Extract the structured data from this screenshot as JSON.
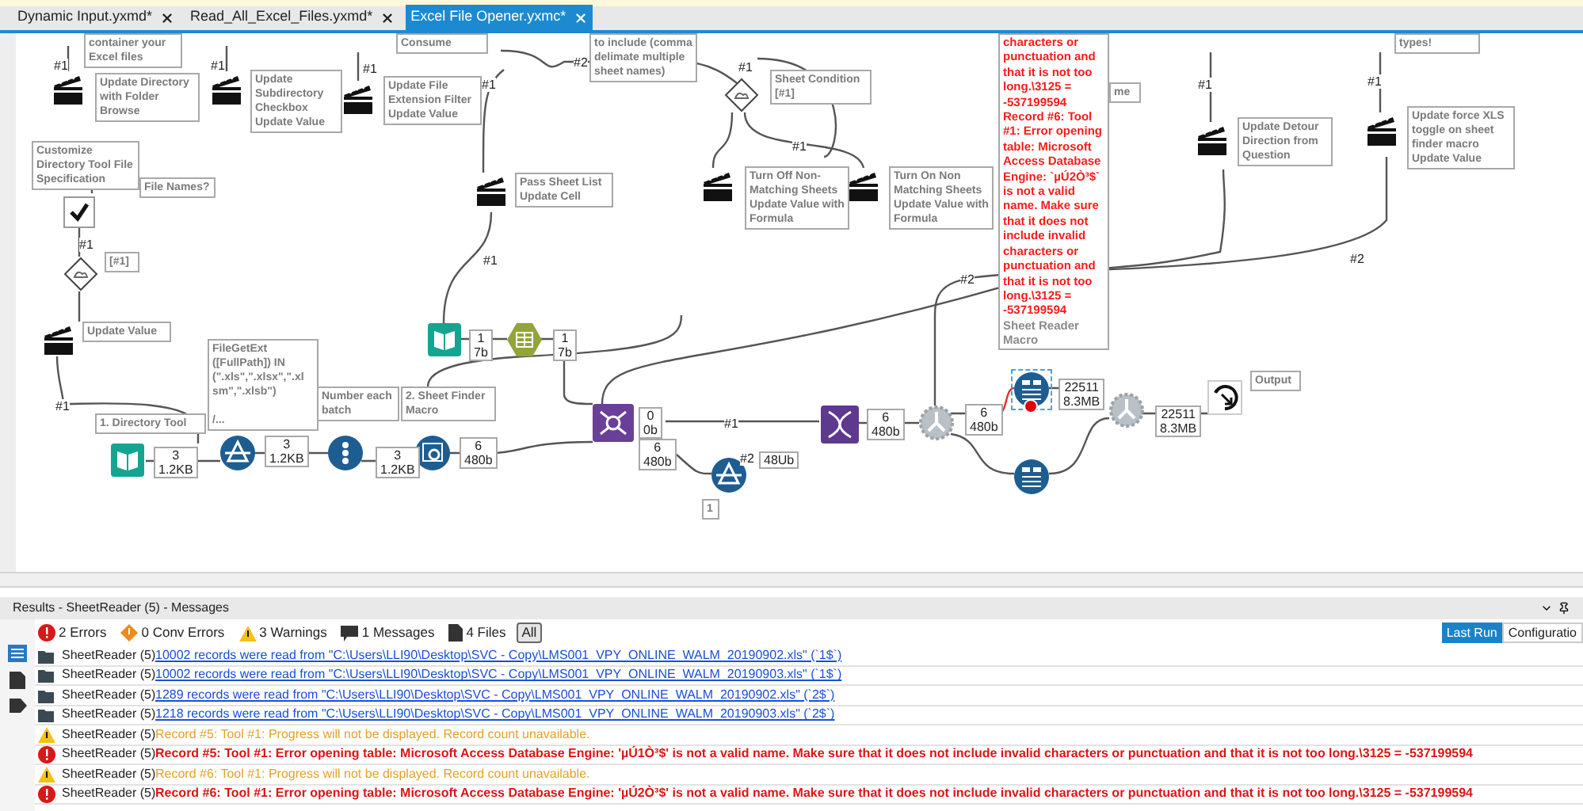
{
  "tabs": [
    {
      "label": "Dynamic Input.yxmd*",
      "selected": false
    },
    {
      "label": "Read_All_Excel_Files.yxmd*",
      "selected": false
    },
    {
      "label": "Excel File Opener.yxmc*",
      "selected": true
    }
  ],
  "canvas": {
    "annotations": [
      "container your Excel files",
      "Consume",
      "to include (comma delimate multiple sheet names)",
      "types!",
      "Update Directory with Folder Browse",
      "Update Subdirectory Checkbox Update Value",
      "Update File Extension Filter Update Value",
      "Sheet Condition [#1]",
      "me",
      "Update Detour Direction from Question",
      "Update force XLS toggle on sheet finder macro Update Value",
      "Customize Directory Tool File Specification",
      "File Names?",
      "Pass Sheet List Update Cell",
      "Turn Off Non-Matching Sheets Update Value with Formula",
      "Turn On Non Matching Sheets Update Value with Formula",
      "[#1]",
      "Update Value",
      "FileGetExt\n([FullPath]) IN\n(\".xls\",\".xlsx\",\".xl\nsm\",\".xlsb\")\n\n/...",
      "Number each batch",
      "2. Sheet Finder Macro",
      "1. Directory Tool",
      "Output",
      "1"
    ],
    "error_tooltip": {
      "message": "characters or punctuation and that it is not too long.\\3125 = -537199594 Record #6: Tool #1: Error opening table: Microsoft Access Database Engine: `µÚ2Ò³$` is not a valid name. Make sure that it does not include invalid characters or punctuation and that it is not too long.\\3125 = -537199594",
      "caption": "Sheet Reader Macro"
    },
    "counts": [
      {
        "records": "3",
        "size": "1.2KB"
      },
      {
        "records": "3",
        "size": "1.2KB"
      },
      {
        "records": "3",
        "size": "1.2KB"
      },
      {
        "records": "6",
        "size": "480b"
      },
      {
        "records": "1",
        "size": "7b"
      },
      {
        "records": "1",
        "size": "7b"
      },
      {
        "records": "0",
        "size": "0b"
      },
      {
        "records": "6",
        "size": "480b"
      },
      {
        "size": "48Ub"
      },
      {
        "records": "6",
        "size": "480b"
      },
      {
        "records": "6",
        "size": "480b"
      },
      {
        "records": "22511",
        "size": "8.3MB"
      },
      {
        "records": "22511",
        "size": "8.3MB"
      }
    ],
    "connection_labels": [
      "#1",
      "#1",
      "#1",
      "#2",
      "#1",
      "#1",
      "#1",
      "#1",
      "#1",
      "#1",
      "#1",
      "#2",
      "#2",
      "#1",
      "#1",
      "#2"
    ],
    "tools": [
      {
        "kind": "action",
        "error": false,
        "selected": false
      },
      {
        "kind": "action",
        "error": false,
        "selected": false
      },
      {
        "kind": "action",
        "error": false,
        "selected": false
      },
      {
        "kind": "action",
        "error": false,
        "selected": false
      },
      {
        "kind": "check",
        "error": false,
        "selected": false
      },
      {
        "kind": "condition",
        "error": false,
        "selected": false
      },
      {
        "kind": "condition",
        "error": false,
        "selected": false
      },
      {
        "kind": "action",
        "error": false,
        "selected": false
      },
      {
        "kind": "action",
        "error": false,
        "selected": false
      },
      {
        "kind": "action",
        "error": false,
        "selected": false
      },
      {
        "kind": "action",
        "error": false,
        "selected": false
      },
      {
        "kind": "action",
        "error": false,
        "selected": false
      },
      {
        "kind": "directory",
        "error": false,
        "selected": false
      },
      {
        "kind": "text-input",
        "error": false,
        "selected": false
      },
      {
        "kind": "directory",
        "error": false,
        "selected": false
      },
      {
        "kind": "filter",
        "error": false,
        "selected": false
      },
      {
        "kind": "record-id",
        "error": false,
        "selected": false
      },
      {
        "kind": "sheet-finder",
        "error": false,
        "selected": false
      },
      {
        "kind": "join",
        "error": false,
        "selected": false
      },
      {
        "kind": "filter",
        "error": false,
        "selected": false
      },
      {
        "kind": "transpose",
        "error": false,
        "selected": false
      },
      {
        "kind": "detour",
        "error": false,
        "selected": false
      },
      {
        "kind": "sheet-reader",
        "error": true,
        "selected": true
      },
      {
        "kind": "detour",
        "error": false,
        "selected": false
      },
      {
        "kind": "sheet-reader",
        "error": false,
        "selected": false
      },
      {
        "kind": "output",
        "error": false,
        "selected": false
      }
    ]
  },
  "results": {
    "title": "Results - SheetReader (5) - Messages",
    "filters": [
      {
        "kind": "error",
        "label": "2 Errors",
        "selected": false
      },
      {
        "kind": "conv",
        "label": "0 Conv Errors",
        "selected": false
      },
      {
        "kind": "warning",
        "label": "3 Warnings",
        "selected": false
      },
      {
        "kind": "message",
        "label": "1 Messages",
        "selected": false
      },
      {
        "kind": "file",
        "label": "4 Files",
        "selected": false
      },
      {
        "kind": "all",
        "label": "All",
        "selected": true
      }
    ],
    "views": [
      {
        "label": "Last Run",
        "selected": true
      },
      {
        "label": "Configuratio",
        "selected": false
      }
    ],
    "messages": [
      {
        "kind": "file",
        "tool": "SheetReader (5)",
        "text": "10002 records were read from \"C:\\Users\\LLI90\\Desktop\\SVC - Copy\\LMS001_VPY_ONLINE_WALM_20190902.xls\" (`1$`)"
      },
      {
        "kind": "file",
        "tool": "SheetReader (5)",
        "text": "10002 records were read from \"C:\\Users\\LLI90\\Desktop\\SVC - Copy\\LMS001_VPY_ONLINE_WALM_20190903.xls\" (`1$`)"
      },
      {
        "kind": "file",
        "tool": "SheetReader (5)",
        "text": "1289 records were read from \"C:\\Users\\LLI90\\Desktop\\SVC - Copy\\LMS001_VPY_ONLINE_WALM_20190902.xls\" (`2$`)"
      },
      {
        "kind": "file",
        "tool": "SheetReader (5)",
        "text": "1218 records were read from \"C:\\Users\\LLI90\\Desktop\\SVC - Copy\\LMS001_VPY_ONLINE_WALM_20190903.xls\" (`2$`)"
      },
      {
        "kind": "warning",
        "tool": "SheetReader (5)",
        "text": "Record #5: Tool #1: Progress will not be displayed.  Record count unavailable."
      },
      {
        "kind": "error",
        "tool": "SheetReader (5)",
        "text": "Record #5: Tool #1: Error opening table: Microsoft Access Database Engine: 'µÚ1Ò³$' is not a valid name. Make sure that it does not include invalid characters or punctuation and that it is not too long.\\3125 = -537199594"
      },
      {
        "kind": "warning",
        "tool": "SheetReader (5)",
        "text": "Record #6: Tool #1: Progress will not be displayed.  Record count unavailable."
      },
      {
        "kind": "error",
        "tool": "SheetReader (5)",
        "text": "Record #6: Tool #1: Error opening table: Microsoft Access Database Engine: 'µÚ2Ò³$' is not a valid name. Make sure that it does not include invalid characters or punctuation and that it is not too long.\\3125 = -537199594"
      }
    ]
  }
}
